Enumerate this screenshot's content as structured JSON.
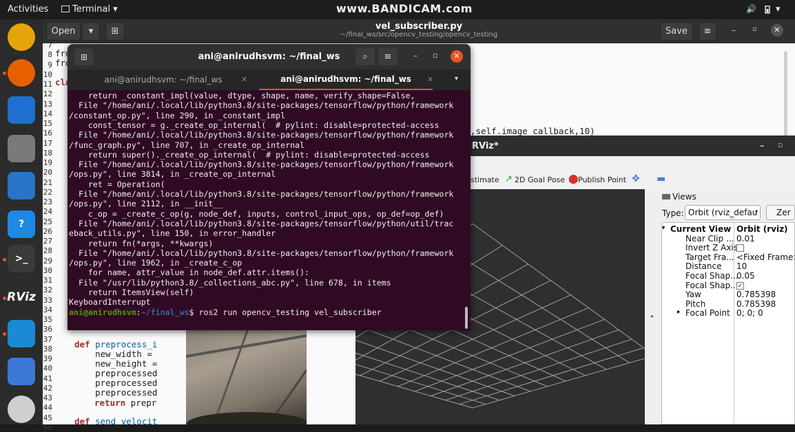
{
  "topbar": {
    "activities": "Activities",
    "app_menu": "Terminal",
    "app_menu_caret": "▾",
    "watermark": "www.BANDICAM.com",
    "volume_icon": "🔊",
    "status_caret": "▾"
  },
  "dock": {
    "items": [
      {
        "name": "rhythmbox-icon",
        "bg": "#e5a50a",
        "glyph": ""
      },
      {
        "name": "firefox-icon",
        "bg": "#e66000",
        "glyph": ""
      },
      {
        "name": "thunderbird-icon",
        "bg": "#1f6fd1",
        "glyph": ""
      },
      {
        "name": "files-icon",
        "bg": "#7a7a7a",
        "glyph": ""
      },
      {
        "name": "writer-icon",
        "bg": "#2a74c7",
        "glyph": ""
      },
      {
        "name": "help-icon",
        "bg": "#1e88e5",
        "glyph": "?"
      },
      {
        "name": "terminal-icon",
        "bg": "#3a3a3a",
        "glyph": ">_"
      },
      {
        "name": "rviz-icon",
        "bg": "#2b2b2b",
        "glyph": "RViz"
      },
      {
        "name": "vscode-icon",
        "bg": "#1a8ad4",
        "glyph": ""
      },
      {
        "name": "text-editor-icon",
        "bg": "#3b78d8",
        "glyph": ""
      },
      {
        "name": "disc-icon",
        "bg": "#cfcfcf",
        "glyph": ""
      }
    ]
  },
  "gedit": {
    "open_label": "Open",
    "title": "vel_subscriber.py",
    "subtitle": "~/final_ws/src/opencv_testing/opencv_testing",
    "save_label": "Save",
    "line_numbers": [
      "7",
      "8",
      "9",
      "10",
      "11",
      "12",
      "13",
      "14",
      "15",
      "16",
      "17",
      "18",
      "19",
      "20",
      "21",
      "22",
      "23",
      "24",
      "25",
      "26",
      "27",
      "28",
      "29",
      "30",
      "31",
      "32",
      "33",
      "34",
      "35",
      "36",
      "37",
      "38",
      "39",
      "40",
      "41",
      "42",
      "43",
      "44",
      "45",
      "46"
    ],
    "code_lines": {
      "l8": "fro",
      "l9": "fro",
      "l11": "cla",
      "l16": ",self.image_callback,10)",
      "l38_kw": "def",
      "l38": " preprocess_i",
      "l39": "    new_width =",
      "l40": "    new_height =",
      "l41": "    preprocessed",
      "l42": "    preprocessed",
      "l43": "    preprocessed",
      "l44_kw": "return",
      "l44": " prepr",
      "l46_kw": "def",
      "l46": " send_velocit"
    }
  },
  "terminal": {
    "title": "ani@anirudhsvm: ~/final_ws",
    "tab1": "ani@anirudhsvm: ~/final_ws",
    "tab2": "ani@anirudhsvm: ~/final_ws",
    "lines": [
      "    return _constant_impl(value, dtype, shape, name, verify_shape=False,",
      "  File \"/home/ani/.local/lib/python3.8/site-packages/tensorflow/python/framework",
      "/constant_op.py\", line 290, in _constant_impl",
      "    const_tensor = g._create_op_internal(  # pylint: disable=protected-access",
      "  File \"/home/ani/.local/lib/python3.8/site-packages/tensorflow/python/framework",
      "/func_graph.py\", line 707, in _create_op_internal",
      "    return super()._create_op_internal(  # pylint: disable=protected-access",
      "  File \"/home/ani/.local/lib/python3.8/site-packages/tensorflow/python/framework",
      "/ops.py\", line 3814, in _create_op_internal",
      "    ret = Operation(",
      "  File \"/home/ani/.local/lib/python3.8/site-packages/tensorflow/python/framework",
      "/ops.py\", line 2112, in __init__",
      "    c_op = _create_c_op(g, node_def, inputs, control_input_ops, op_def=op_def)",
      "  File \"/home/ani/.local/lib/python3.8/site-packages/tensorflow/python/util/trac",
      "eback_utils.py\", line 150, in error_handler",
      "    return fn(*args, **kwargs)",
      "  File \"/home/ani/.local/lib/python3.8/site-packages/tensorflow/python/framework",
      "/ops.py\", line 1962, in _create_c_op",
      "    for name, attr_value in node_def.attr.items():",
      "  File \"/usr/lib/python3.8/_collections_abc.py\", line 678, in items",
      "    return ItemsView(self)",
      "KeyboardInterrupt"
    ],
    "prompt_user": "ani@anirudhsvm",
    "prompt_colon": ":",
    "prompt_path": "~/final_ws",
    "prompt_cmd": "$ ros2 run opencv_testing vel_subscriber"
  },
  "rviz": {
    "title": "RViz*",
    "tools": {
      "estimate": "stimate",
      "goal": "2D Goal Pose",
      "publish": "Publish Point"
    },
    "views": {
      "header": "Views",
      "type_label": "Type:",
      "type_value": "Orbit (rviz_defau",
      "zero_button": "Zer",
      "props": [
        {
          "name": "Current View",
          "value": "Orbit (rviz)",
          "bold": true
        },
        {
          "name": "Near Clip ...",
          "value": "0.01"
        },
        {
          "name": "Invert Z Axis",
          "value": ""
        },
        {
          "name": "Target Fra...",
          "value": "<Fixed Frame>"
        },
        {
          "name": "Distance",
          "value": "10"
        },
        {
          "name": "Focal Shap...",
          "value": "0.05"
        },
        {
          "name": "Focal Shap...",
          "value": "✓"
        },
        {
          "name": "Yaw",
          "value": "0.785398"
        },
        {
          "name": "Pitch",
          "value": "0.785398"
        },
        {
          "name": "Focal Point",
          "value": "0; 0; 0"
        }
      ]
    }
  }
}
